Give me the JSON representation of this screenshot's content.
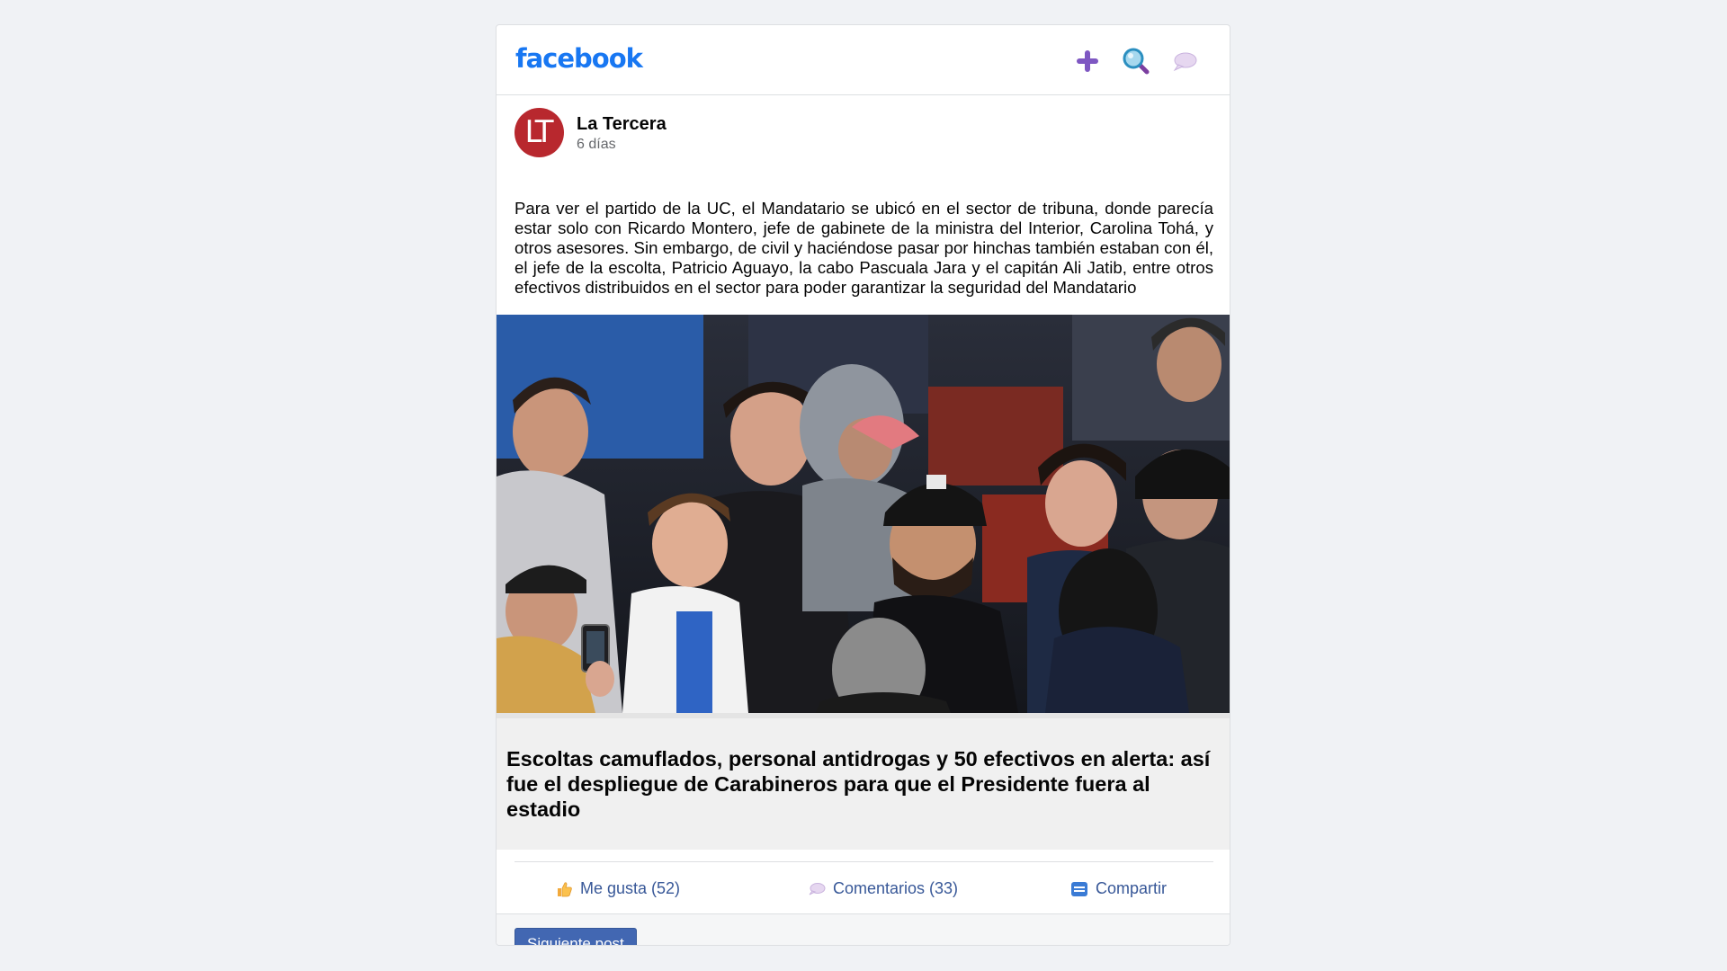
{
  "header": {
    "logo_text": "facebook",
    "icons": [
      "plus-icon",
      "search-icon",
      "chat-icon"
    ]
  },
  "post": {
    "author": "La Tercera",
    "avatar_text": "LT",
    "time": "6 días",
    "text": "Para ver el partido de la UC, el Mandatario se ubicó en el sector de tribuna, donde parecía estar solo con Ricardo Montero, jefe de gabinete de la ministra del Interior, Carolina Tohá, y otros asesores. Sin embargo, de civil y haciéndose pasar por hinchas también estaban con él, el jefe de la escolta, Patricio Aguayo, la cabo Pascuala Jara y el capitán Ali Jatib, entre otros efectivos distribuidos en el sector para poder garantizar la seguridad del Mandatario",
    "image_icon": "crowd-photo",
    "link_headline": "Escoltas camuflados, personal antidrogas y 50 efectivos en alerta: así fue el despliegue de Carabineros para que el Presidente fuera al estadio"
  },
  "actions": {
    "like_label": "Me gusta (52)",
    "comments_label": "Comentarios (33)",
    "share_label": "Compartir"
  },
  "footer": {
    "next_label": "Siguiente post"
  },
  "colors": {
    "brand": "#1877f2",
    "link": "#385898",
    "button": "#4267b2",
    "avatar_bg": "#b8282e"
  }
}
